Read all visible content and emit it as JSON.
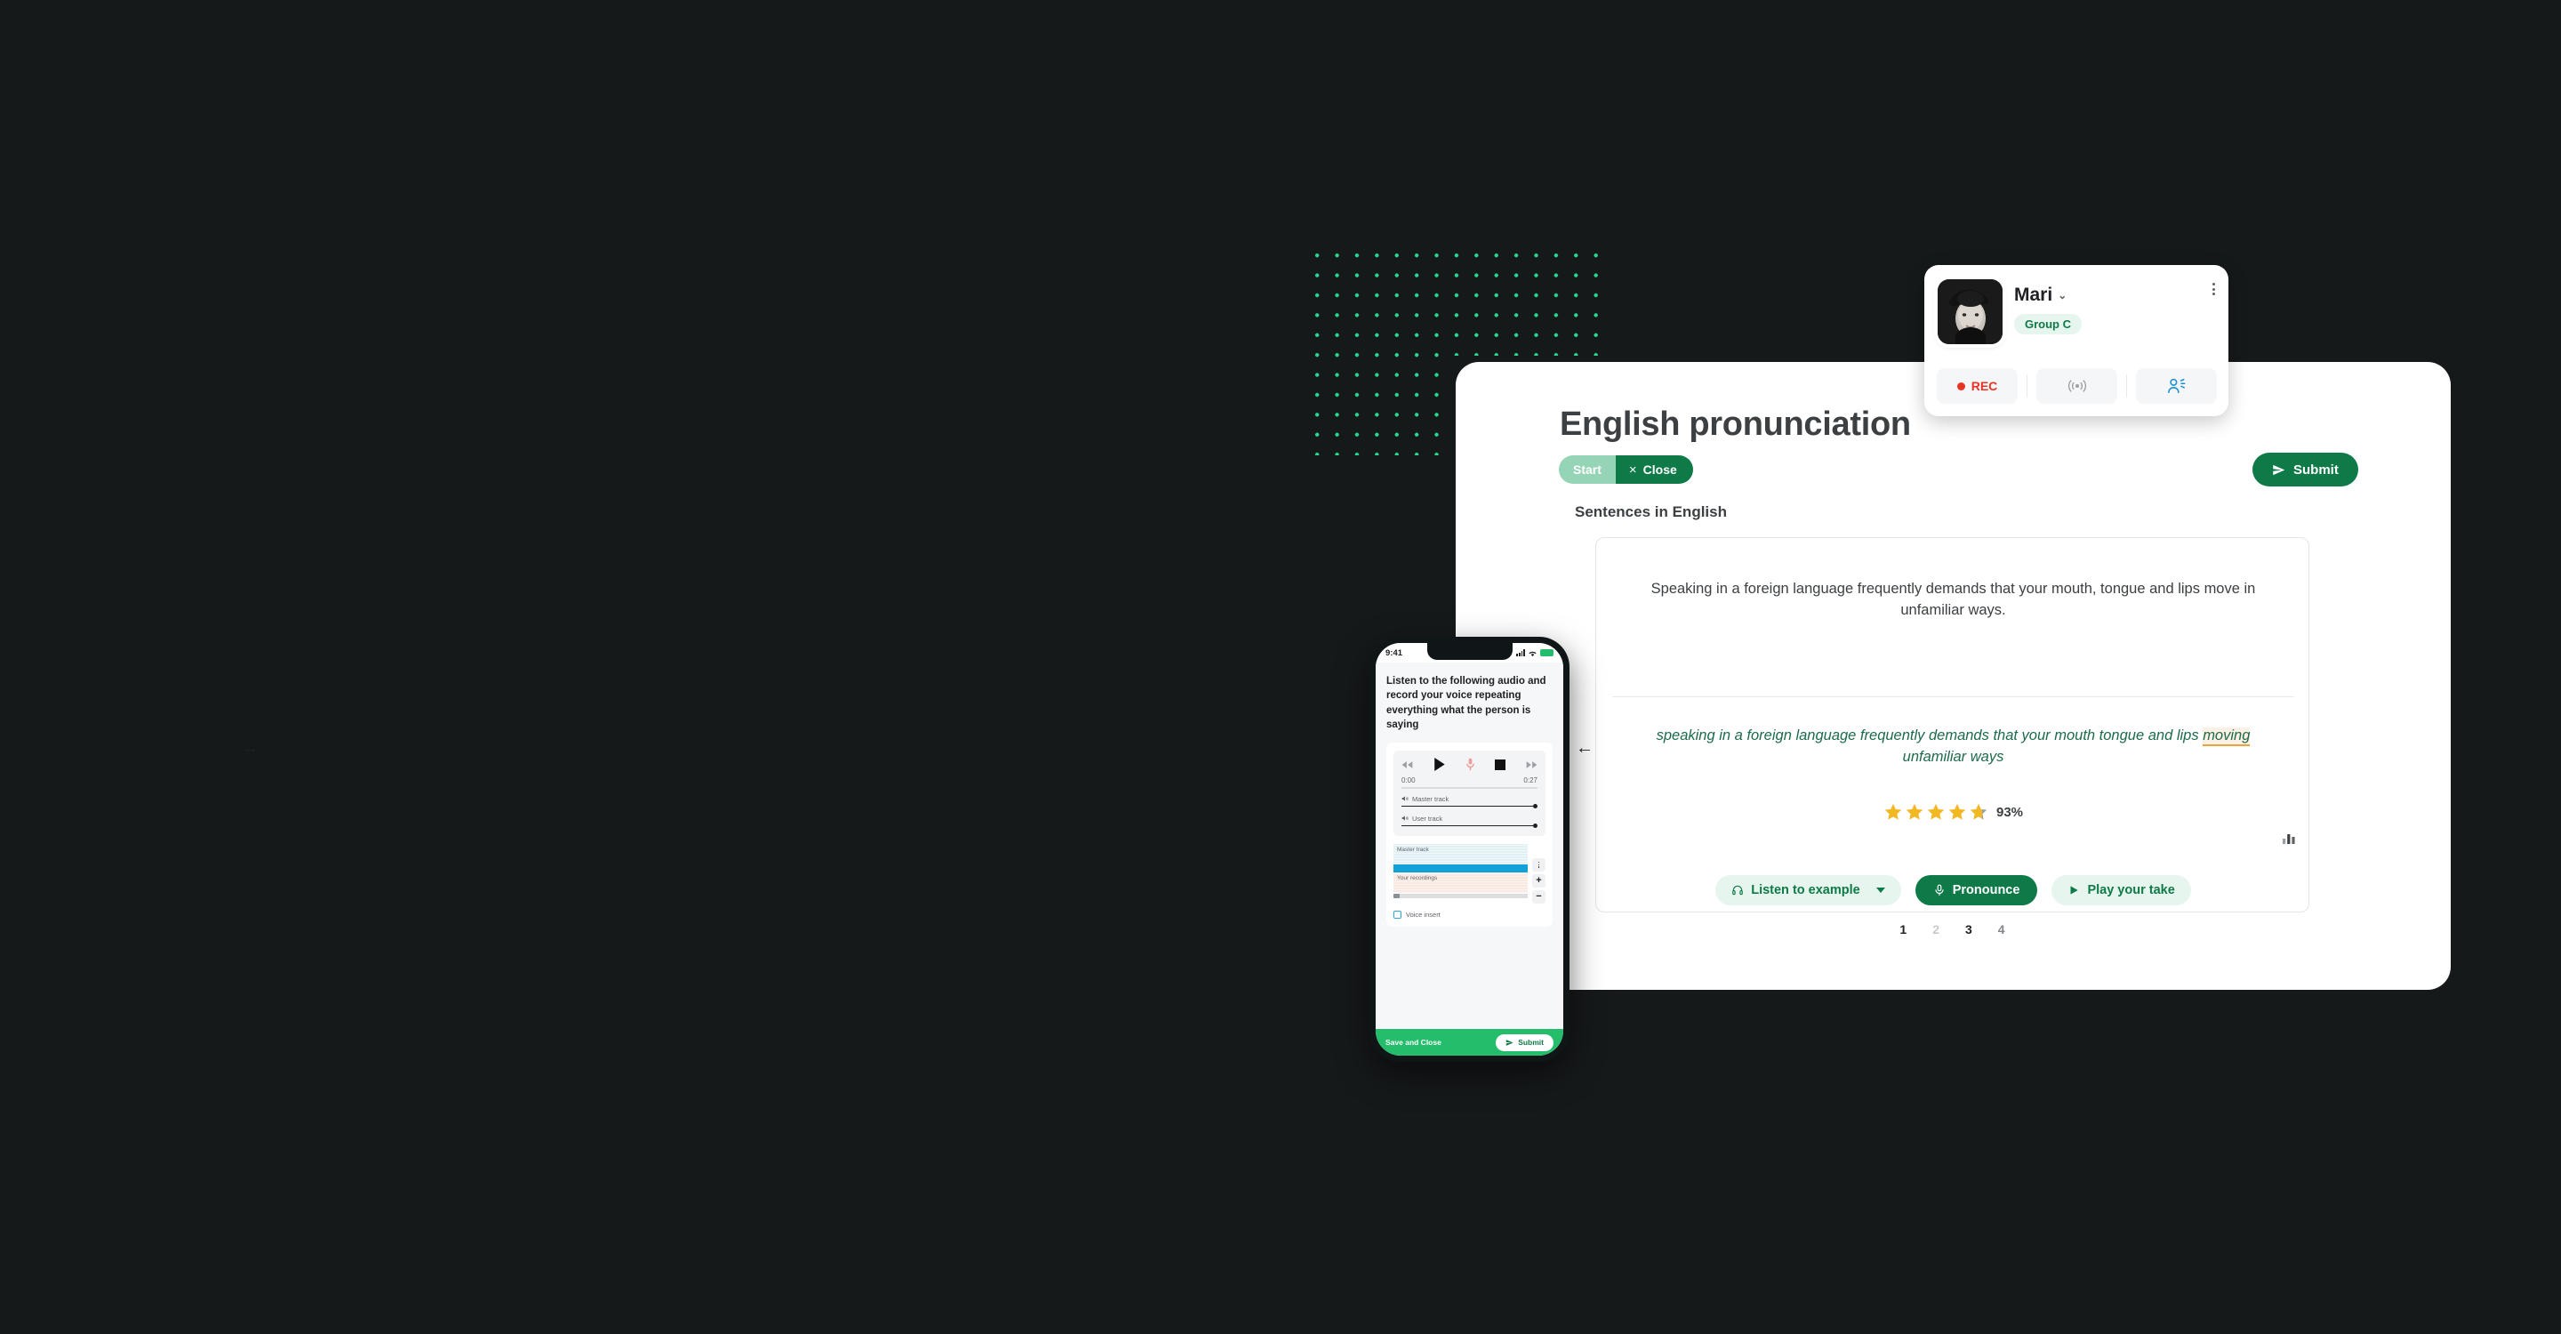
{
  "theme": {
    "bg": "#16191a",
    "accent_green": "#0d7a47",
    "bright_green": "#23bd6b",
    "dot_green": "#27d68f",
    "star_gold": "#f2b824",
    "rec_red": "#ea3323",
    "highlight_amber": "#e8a33d"
  },
  "panel": {
    "title": "English pronunciation",
    "segmented": {
      "start_label": "Start",
      "close_label": "Close",
      "close_mark": "×"
    },
    "section_label": "Sentences in English",
    "submit_label": "Submit"
  },
  "exercise": {
    "prompt": "Speaking in a foreign language frequently demands that your mouth, tongue and lips move in unfamiliar ways.",
    "transcript_before": "speaking in a foreign language frequently demands that your mouth tongue and lips ",
    "transcript_highlight": "moving",
    "transcript_after": " unfamiliar ways",
    "score_percent": "93%",
    "stars_total": 5,
    "stars_filled": 4,
    "actions": {
      "listen_label": "Listen to example",
      "pronounce_label": "Pronounce",
      "play_take_label": "Play your take"
    },
    "pagination": [
      "1",
      "2",
      "3",
      "4"
    ],
    "active_page": "3",
    "nav_prev": "←",
    "nav_next": "→"
  },
  "user_card": {
    "name": "Mari",
    "group": "Group C",
    "rec_label": "REC",
    "controls": [
      "rec-button",
      "broadcast-button",
      "participants-button"
    ]
  },
  "phone": {
    "status": {
      "time": "9:41"
    },
    "instruction": "Listen to the following audio and record your voice repeating everything what the person is saying",
    "player": {
      "time_current": "0:00",
      "time_total": "0:27",
      "master_track_label": "Master track",
      "user_track_label": "User track"
    },
    "tracks": {
      "master_label": "Master track",
      "user_label": "Your recordings",
      "voice_insert_label": "Voice insert"
    },
    "footer": {
      "save_label": "Save and Close",
      "submit_label": "Submit"
    }
  }
}
